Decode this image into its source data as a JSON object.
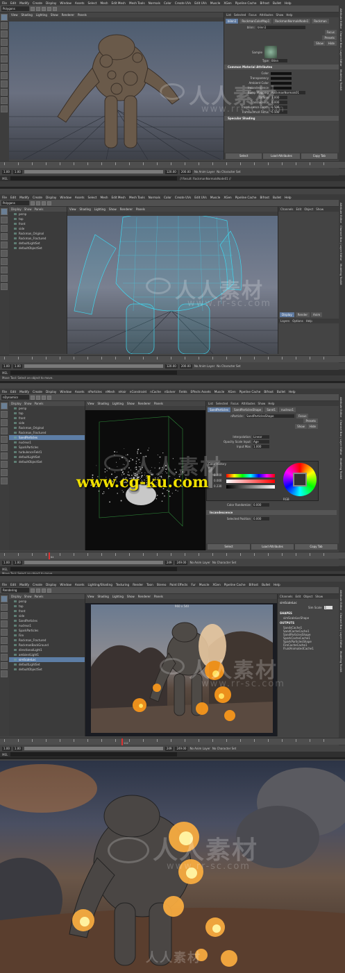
{
  "panel1": {
    "mode": "Polygons",
    "menus": [
      "File",
      "Edit",
      "Modify",
      "Create",
      "Display",
      "Window",
      "Assets",
      "Select",
      "Mesh",
      "Edit Mesh",
      "Mesh Tools",
      "Normals",
      "Color",
      "Create UVs",
      "Edit UVs",
      "Muscle",
      "XGen",
      "Pipeline Cache",
      "Bifrost",
      "Bullet",
      "Help"
    ],
    "vp_menus": [
      "View",
      "Shading",
      "Lighting",
      "Show",
      "Renderer",
      "Panels"
    ],
    "attr_title": "Attribute Editor",
    "attr_menus": [
      "List",
      "Selected",
      "Focus",
      "Attributes",
      "Show",
      "Help"
    ],
    "attr_tabs": [
      "blinn1",
      "RockmanColorMap1",
      "RockmanNormalsNode1",
      "Rockman"
    ],
    "blinn_label": "blinn:",
    "blinn_value": "blinn1",
    "btn_focus": "Focus",
    "btn_presets": "Presets",
    "btn_show": "Show",
    "btn_hide": "Hide",
    "sample_label": "Sample",
    "type_label": "Type",
    "type_value": "Blinn",
    "section": "Common Material Attributes",
    "attrs": [
      "Color",
      "Transparency",
      "Ambient Color",
      "Incandescence",
      "Bump Mapping",
      "Diffuse",
      "Translucence",
      "Translucence Depth",
      "Translucence Focus"
    ],
    "bump_value": "RockmanNormals01",
    "diffuse_value": "1.000",
    "transl_value": "0.000",
    "transl_depth": "0.500",
    "transl_focus": "0.500",
    "section2": "Specular Shading",
    "btn_select": "Select",
    "btn_load": "Load Attributes",
    "btn_copy": "Copy Tab",
    "range_start": "1.00",
    "range_end": "120.00",
    "range_end2": "200.00",
    "anim_layer": "No Anim Layer",
    "char_set": "No Character Set",
    "mel": "MEL",
    "result": "// Result: RockmanNormalsNode01 //",
    "side_tabs": [
      "Attribute Editor",
      "Channel Box / Layer Editor",
      "Modeling Toolkit"
    ]
  },
  "panel2": {
    "mode": "Polygons",
    "menus": [
      "File",
      "Edit",
      "Modify",
      "Create",
      "Display",
      "Window",
      "Assets",
      "Select",
      "Mesh",
      "Edit Mesh",
      "Mesh Tools",
      "Normals",
      "Color",
      "Create UVs",
      "Edit UVs",
      "Muscle",
      "XGen",
      "Pipeline Cache",
      "Bifrost",
      "Bullet",
      "Help"
    ],
    "outliner_menus": [
      "Display",
      "Show",
      "Panels"
    ],
    "outliner_items": [
      "persp",
      "top",
      "front",
      "side",
      "Rockman_Original",
      "Rockman_Fractured",
      "defaultLightSet",
      "defaultObjectSet"
    ],
    "vp_menus": [
      "View",
      "Shading",
      "Lighting",
      "Show",
      "Renderer",
      "Panels"
    ],
    "channel_menus": [
      "Channels",
      "Edit",
      "Object",
      "Show"
    ],
    "layer_tabs": [
      "Display",
      "Render",
      "Anim"
    ],
    "layer_menus": [
      "Layers",
      "Options",
      "Help"
    ],
    "range_start": "1.00",
    "range_end": "120.00",
    "range_end2": "200.00",
    "anim_layer": "No Anim Layer",
    "char_set": "No Character Set",
    "mel": "MEL",
    "help": "Move Tool: Select an object to move.",
    "side_tabs": [
      "Attribute Editor",
      "Channel Box / Layer Editor",
      "Modeling Toolkit"
    ]
  },
  "panel3": {
    "mode": "nDynamics",
    "menus": [
      "File",
      "Edit",
      "Modify",
      "Create",
      "Display",
      "Window",
      "Assets",
      "nParticles",
      "nMesh",
      "nHair",
      "nConstraint",
      "nCache",
      "nSolver",
      "Fields",
      "Effects Assets",
      "Muscle",
      "XGen",
      "Pipeline Cache",
      "Bifrost",
      "Bullet",
      "Help"
    ],
    "outliner_menus": [
      "Display",
      "Show",
      "Panels"
    ],
    "outliner_items": [
      "persp",
      "top",
      "front",
      "side",
      "Rockman_Original",
      "Rockman_Fractured",
      "SandParticles",
      "nucleus1",
      "SparkParticles",
      "turbulenceField1",
      "defaultLightSet",
      "defaultObjectSet"
    ],
    "selected_index": 6,
    "vp_menus": [
      "View",
      "Shading",
      "Lighting",
      "Show",
      "Renderer",
      "Panels"
    ],
    "attr_menus": [
      "List",
      "Selected",
      "Focus",
      "Attributes",
      "Show",
      "Help"
    ],
    "attr_tabs": [
      "SandParticles",
      "SandParticlesShape",
      "Sand1",
      "nucleus1"
    ],
    "nparticle_label": "nParticle:",
    "nparticle_value": "SandParticlesShape",
    "btn_focus": "Focus",
    "btn_presets": "Presets",
    "btn_show": "Show",
    "btn_hide": "Hide",
    "interp_label": "Interpolation",
    "interp_value": "Linear",
    "opacity_label": "Opacity Scale Input",
    "opacity_value": "Age",
    "input_max_label": "Input Max",
    "input_max_value": "1.000",
    "color_history": "Color History",
    "color_label": "Color",
    "color_rand": "Color Randomize",
    "color_rand_value": "0.000",
    "rgb_mode": "RGB",
    "h_value": "0.000",
    "s_value": "0.000",
    "v_value": "0.230",
    "section": "Incandescence",
    "sel_pos_label": "Selected Position",
    "sel_pos_value": "0.000",
    "btn_select": "Select",
    "btn_load": "Load Attributes",
    "btn_copy": "Copy Tab",
    "frame_label": "64",
    "range_start": "1.00",
    "range_end": "249",
    "range_end2": "249.00",
    "anim_layer": "No Anim Layer",
    "char_set": "No Character Set",
    "mel": "MEL",
    "help": "Move Tool: Select an object to move.",
    "watermark_url": "www.cg-ku.com",
    "side_tabs": [
      "Attribute Editor",
      "Channel Box / Layer Editor",
      "Modeling Toolkit"
    ]
  },
  "panel4": {
    "mode": "Rendering",
    "menus": [
      "File",
      "Edit",
      "Modify",
      "Create",
      "Display",
      "Window",
      "Assets",
      "Lighting/Shading",
      "Texturing",
      "Render",
      "Toon",
      "Stereo",
      "Paint Effects",
      "Fur",
      "Muscle",
      "XGen",
      "Pipeline Cache",
      "Bifrost",
      "Bullet",
      "Help"
    ],
    "outliner_menus": [
      "Display",
      "Show",
      "Panels"
    ],
    "outliner_items": [
      "persp",
      "top",
      "front",
      "side",
      "SandParticles",
      "nucleus1",
      "SparkParticles",
      "Fire",
      "Rockman_Fractured",
      "RockmanBackGround",
      "directionalLight1",
      "ambientLight1",
      "simScaleLoc",
      "defaultLightSet",
      "defaultObjectSet"
    ],
    "selected_index": 12,
    "vp_menus": [
      "View",
      "Shading",
      "Lighting",
      "Show",
      "Renderer",
      "Panels"
    ],
    "res_label": "960 x 540",
    "channel_menus": [
      "Channels",
      "Edit",
      "Object",
      "Show"
    ],
    "channel_title": "simScaleLoc",
    "channel_attr": "Sim Scale",
    "channel_value": "1",
    "shapes_title": "SHAPES",
    "shapes": [
      "simScaleLocShape"
    ],
    "outputs_title": "OUTPUTS",
    "outputs": [
      "SandsCache1",
      "SandCacheCache1",
      "SandParticlesShape",
      "SparkCacheCache1",
      "SparkParticlesShape",
      "FireCacheCache1",
      "FluidAnimatedCache1"
    ],
    "frame_label": "112",
    "range_start": "1.00",
    "range_end": "249",
    "range_end2": "249.00",
    "anim_layer": "No Anim Layer",
    "char_set": "No Character Set",
    "mel": "MEL",
    "side_tabs": [
      "Attribute Editor",
      "Channel Box / Layer Editor",
      "Modeling Toolkit"
    ]
  },
  "watermark_cn": "人人素材",
  "watermark_en": "www.rr-sc.com",
  "colors": {
    "ui_bg": "#444444",
    "selection": "#5d7ea6",
    "wire": "#3fd8f0",
    "fire": "#ff9a1a",
    "sky": "#3d4a64"
  }
}
